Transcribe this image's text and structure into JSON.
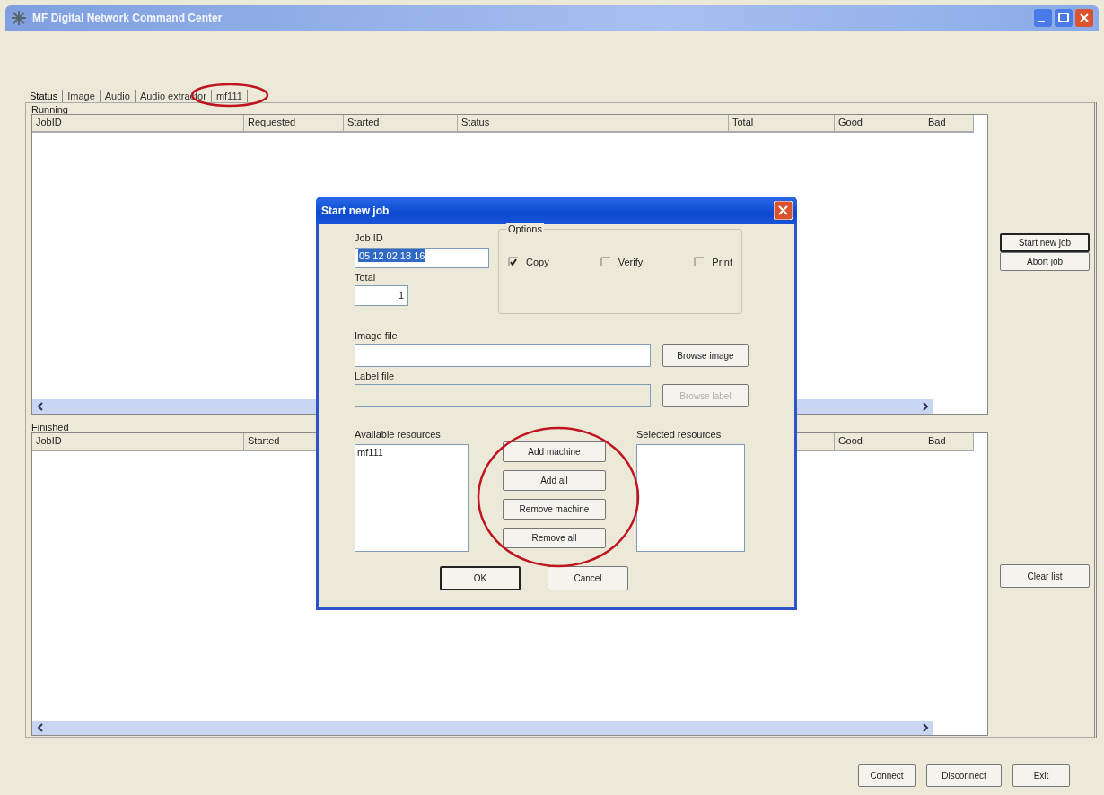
{
  "window": {
    "title": "MF Digital Network Command Center"
  },
  "tabs": [
    {
      "label": "Status",
      "selected": true
    },
    {
      "label": "Image",
      "selected": false
    },
    {
      "label": "Audio",
      "selected": false
    },
    {
      "label": "Audio extractor",
      "selected": false
    },
    {
      "label": "mf111",
      "selected": false
    }
  ],
  "running": {
    "label": "Running",
    "columns": [
      "JobID",
      "Requested",
      "Started",
      "Status",
      "Total",
      "Good",
      "Bad"
    ]
  },
  "finished": {
    "label": "Finished",
    "columns": [
      "JobID",
      "Started",
      "Good",
      "Bad"
    ]
  },
  "side_buttons": [
    {
      "label": "Start new job",
      "focused": true
    },
    {
      "label": "Abort job",
      "focused": false
    }
  ],
  "clear_button": "Clear list",
  "bottom_buttons": [
    "Connect",
    "Disconnect",
    "Exit"
  ],
  "dialog": {
    "title": "Start new job",
    "job_id": {
      "label": "Job ID",
      "value": "05 12 02 18 16",
      "selected": true
    },
    "total": {
      "label": "Total",
      "value": "1"
    },
    "options": {
      "label": "Options",
      "items": [
        {
          "label": "Copy",
          "checked": true
        },
        {
          "label": "Verify",
          "checked": false
        },
        {
          "label": "Print",
          "checked": false
        }
      ]
    },
    "image_file": {
      "label": "Image file",
      "button": "Browse image",
      "disabled": false
    },
    "label_file": {
      "label": "Label file",
      "button": "Browse label",
      "disabled": true
    },
    "available": {
      "label": "Available resources",
      "items": [
        "mf111"
      ]
    },
    "selected_resources": {
      "label": "Selected resources"
    },
    "actions": [
      "Add machine",
      "Add all",
      "Remove machine",
      "Remove all"
    ],
    "buttons": [
      {
        "label": "OK",
        "default": true
      },
      {
        "label": "Cancel",
        "default": false
      }
    ]
  }
}
